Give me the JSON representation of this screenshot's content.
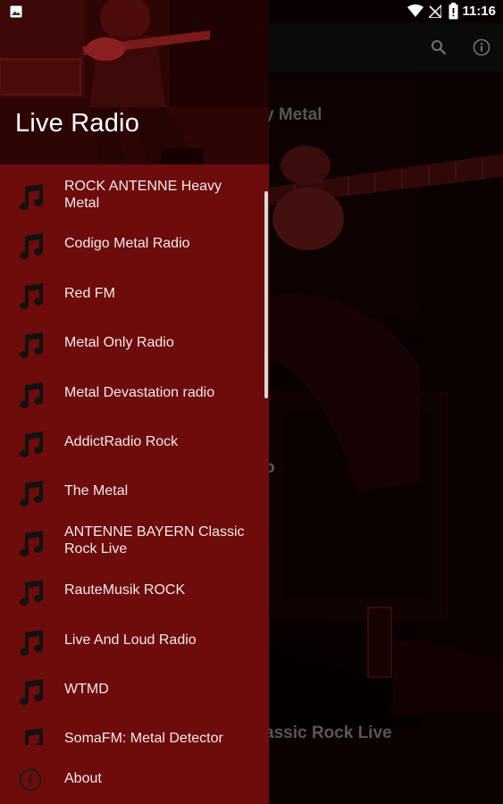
{
  "status_bar": {
    "time": "11:16",
    "icons": [
      "image-notification-icon",
      "wifi-icon",
      "no-signal-icon",
      "battery-icon"
    ]
  },
  "toolbar": {
    "icons": [
      "search-icon",
      "info-icon"
    ]
  },
  "background": {
    "visible_texts": [
      "y Metal",
      "o",
      "assic Rock Live"
    ]
  },
  "drawer": {
    "title": "Live Radio",
    "stations": [
      {
        "label": "ROCK ANTENNE Heavy Metal",
        "icon": "music-note-icon"
      },
      {
        "label": "Codigo Metal Radio",
        "icon": "music-note-icon"
      },
      {
        "label": "Red FM",
        "icon": "music-note-icon"
      },
      {
        "label": "Metal Only Radio",
        "icon": "music-note-icon"
      },
      {
        "label": "Metal Devastation radio",
        "icon": "music-note-icon"
      },
      {
        "label": "AddictRadio Rock",
        "icon": "music-note-icon"
      },
      {
        "label": "The Metal",
        "icon": "music-note-icon"
      },
      {
        "label": "ANTENNE BAYERN Classic Rock Live",
        "icon": "music-note-icon"
      },
      {
        "label": "RauteMusik ROCK",
        "icon": "music-note-icon"
      },
      {
        "label": "Live And Loud Radio",
        "icon": "music-note-icon"
      },
      {
        "label": "WTMD",
        "icon": "music-note-icon"
      },
      {
        "label": "SomaFM: Metal Detector",
        "icon": "music-note-icon"
      }
    ],
    "about": {
      "label": "About",
      "icon": "info-icon"
    }
  },
  "colors": {
    "drawer_background": "#6e0b0b",
    "toolbar_background": "#141414",
    "text_primary": "#f1eaea"
  }
}
